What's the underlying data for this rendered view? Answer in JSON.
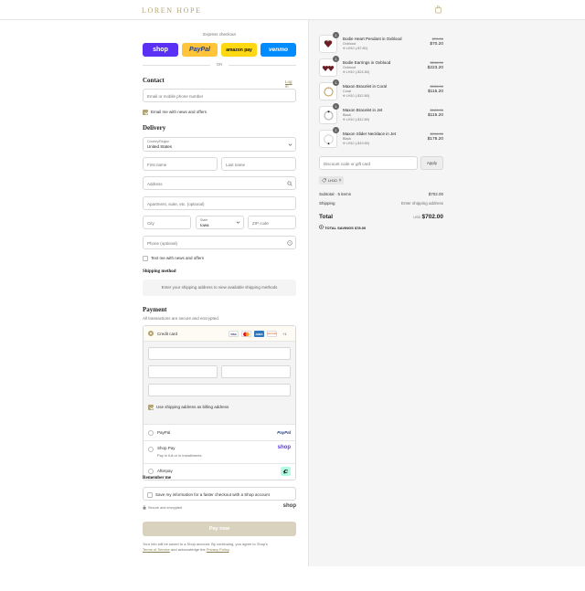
{
  "header": {
    "brand": "LOREN HOPE",
    "bag_icon": "shopping-bag-icon"
  },
  "express": {
    "title": "Express checkout",
    "buttons": [
      "shop",
      "PayPal",
      "amazon pay",
      "venmo"
    ],
    "or": "OR",
    "colors": {
      "shop": "#5a31f4",
      "paypal": "#ffc439",
      "amazon": "#ffd814",
      "venmo": "#008cff"
    }
  },
  "contact": {
    "title": "Contact",
    "login_link": "Log in",
    "email_placeholder": "Email or mobile phone number",
    "news_label": "Email me with news and offers"
  },
  "delivery": {
    "title": "Delivery",
    "country_label": "Country/Region",
    "country_value": "United States",
    "first_name": "First name",
    "last_name": "Last name",
    "address": "Address",
    "apartment": "Apartment, suite, etc. (optional)",
    "city": "City",
    "state_label": "State",
    "state_value": "Iowa",
    "zip": "ZIP code",
    "phone": "Phone (optional)",
    "text_label": "Text me with news and offers"
  },
  "shipping": {
    "title": "Shipping method",
    "message": "Enter your shipping address to view available shipping methods"
  },
  "payment": {
    "title": "Payment",
    "subtitle": "All transactions are secure and encrypted.",
    "credit_card": "Credit card",
    "card_brands": [
      "VISA",
      "MC",
      "AMEX",
      "DISCOVER",
      "+1"
    ],
    "billing_label": "Use shipping address as billing address",
    "paypal": "PayPal",
    "paypal_logo": "PayPal",
    "shop_pay": "Shop Pay",
    "shop_pay_sub": "Pay in full or in installments",
    "shop_logo": "shop",
    "afterpay": "Afterpay"
  },
  "remember": {
    "title": "Remember me",
    "label": "Save my information for a faster checkout with a Shop account",
    "secure": "Secure and encrypted",
    "shop_logo": "shop"
  },
  "pay_now": "Pay now",
  "fine_print": {
    "line1": "Your info will be saved to a Shop account. By continuing, you agree to Shop's",
    "tos": "Terms of Service",
    "mid": " and acknowledge the ",
    "privacy": "Privacy Policy",
    "end": "."
  },
  "cart": {
    "items": [
      {
        "qty": "1",
        "name": "Bodie Heart Pendant in Oxblood",
        "variant": "Oxblood",
        "discount": "LH10 (-$7.80)",
        "orig": "$78.00",
        "price": "$70.20"
      },
      {
        "qty": "1",
        "name": "Bodie Earrings in Oxblood",
        "variant": "Oxblood",
        "discount": "LH10 (-$24.80)",
        "orig": "$248.00",
        "price": "$223.20"
      },
      {
        "qty": "1",
        "name": "Maxon Bracelet in Coral",
        "variant": "Coral",
        "discount": "LH10 (-$12.80)",
        "orig": "$128.00",
        "price": "$115.20"
      },
      {
        "qty": "1",
        "name": "Maxon Bracelet in Jet",
        "variant": "Black",
        "discount": "LH10 (-$12.80)",
        "orig": "$128.00",
        "price": "$115.20"
      },
      {
        "qty": "1",
        "name": "Maxon Slider Necklace in Jet",
        "variant": "Black",
        "discount": "LH10 (-$19.80)",
        "orig": "$198.00",
        "price": "$178.20"
      }
    ],
    "discount_placeholder": "Discount code or gift card",
    "apply": "Apply",
    "code": "LH10",
    "subtotal_label": "Subtotal · 5 items",
    "subtotal": "$702.00",
    "shipping_label": "Shipping",
    "shipping_value": "Enter shipping address",
    "total_label": "Total",
    "currency": "USD",
    "total": "$702.00",
    "savings_label": "TOTAL SAVINGS",
    "savings": "$78.00"
  }
}
